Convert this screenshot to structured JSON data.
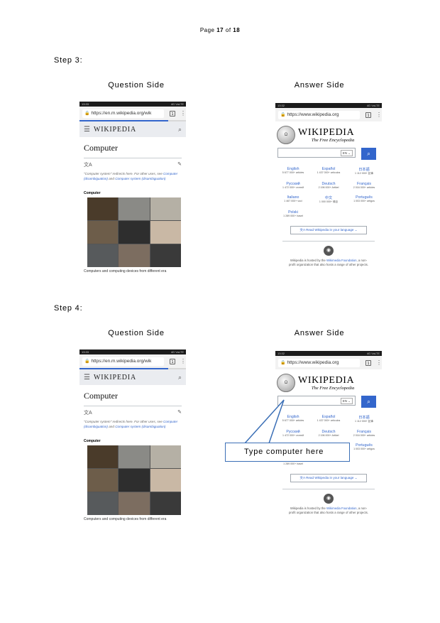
{
  "page": {
    "label": "Page",
    "current": "17",
    "of": "of",
    "total": "18"
  },
  "labels": {
    "question_side": "Question Side",
    "answer_side": "Answer Side"
  },
  "steps": [
    {
      "title": "Step 3:"
    },
    {
      "title": "Step 4:"
    }
  ],
  "question_screen": {
    "status_time": "13:33",
    "status_right": "4G VoLTE",
    "url": "https://en.m.wikipedia.org/wik",
    "tab_count": "1",
    "wiki_logo": "WIKIPEDIA",
    "article_title": "Computer",
    "redirect_note": "\"Computer system\" redirects here. For other uses, see",
    "link1": "Computer (disambiguation)",
    "and": "and",
    "link2": "Computer system (disambiguation)",
    "section_label": "Computer",
    "caption": "Computers and computing devices from different era"
  },
  "answer_screen": {
    "status_time": "13:32",
    "status_right": "4G VoLTE",
    "url": "https://www.wikipedia.org",
    "tab_count": "1",
    "wordmark": "WIKIPEDIA",
    "tagline": "The Free Encyclopedia",
    "lang_select": "EN",
    "languages": [
      {
        "name": "English",
        "count": "5 677 000+ articles"
      },
      {
        "name": "Español",
        "count": "1 437 000+ artículos"
      },
      {
        "name": "日本語",
        "count": "1 112 000+ 記事"
      },
      {
        "name": "Русский",
        "count": "1 472 000+ статей"
      },
      {
        "name": "Deutsch",
        "count": "2 196 000+ Artikel"
      },
      {
        "name": "Français",
        "count": "2 016 000+ articles"
      },
      {
        "name": "Italiano",
        "count": "1 467 000+ voci"
      },
      {
        "name": "中文",
        "count": "1 000 000+ 條目"
      },
      {
        "name": "Português",
        "count": "1 003 000+ artigos"
      },
      {
        "name": "Polski",
        "count": "1 289 000+ haseł"
      }
    ],
    "read_button": "Read Wikipedia in your language",
    "footer_1": "Wikipedia is hosted by the",
    "footer_link": "Wikimedia Foundation",
    "footer_2": ", a non-",
    "footer_3": "profit organization that also hosts a range of other projects."
  },
  "callout": {
    "text": "Type computer here"
  }
}
